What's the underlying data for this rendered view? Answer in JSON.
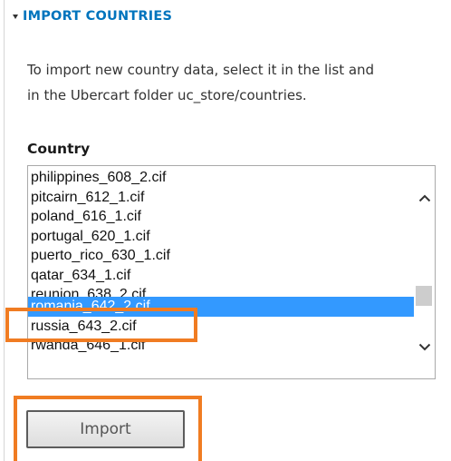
{
  "section": {
    "title": "IMPORT COUNTRIES"
  },
  "description": {
    "line1": "To import new country data, select it in the list and",
    "line2": "in the Ubercart folder uc_store/countries."
  },
  "country_field": {
    "label": "Country",
    "items": [
      "philippines_608_2.cif",
      "pitcairn_612_1.cif",
      "poland_616_1.cif",
      "portugal_620_1.cif",
      "puerto_rico_630_1.cif",
      "qatar_634_1.cif",
      "reunion_638_2.cif",
      "romania_642_2.cif",
      "russia_643_2.cif",
      "rwanda_646_1.cif"
    ],
    "selected": "romania_642_2.cif"
  },
  "import_button": {
    "label": "Import"
  },
  "colors": {
    "link": "#0074bd",
    "selection": "#3399ff",
    "highlight": "#f07c22"
  },
  "icons": {
    "section_toggle": "triangle-down-icon",
    "scroll_up": "chevron-up-icon",
    "scroll_down": "chevron-down-icon"
  }
}
